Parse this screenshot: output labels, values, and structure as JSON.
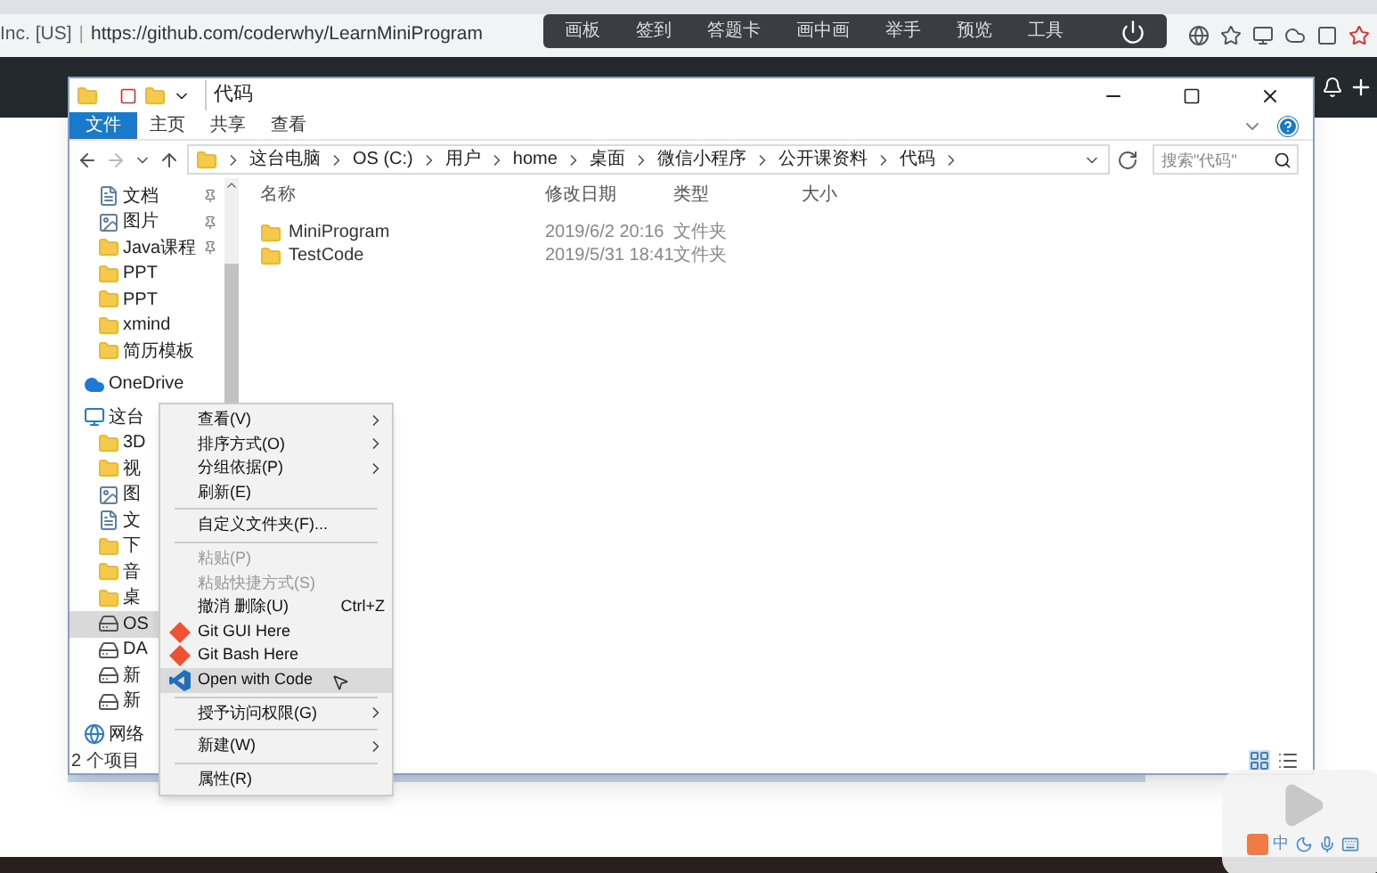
{
  "browser": {
    "site_label": "Inc. [US]",
    "separator": "|",
    "url": "https://github.com/coderwhy/LearnMiniProgram"
  },
  "share_toolbar": {
    "items": [
      "画板",
      "签到",
      "答题卡",
      "画中画",
      "举手",
      "预览",
      "工具"
    ]
  },
  "explorer": {
    "title": "代码",
    "ribbon_tabs": [
      {
        "label": "文件",
        "selected": true
      },
      {
        "label": "主页",
        "selected": false
      },
      {
        "label": "共享",
        "selected": false
      },
      {
        "label": "查看",
        "selected": false
      }
    ],
    "breadcrumb": [
      "这台电脑",
      "OS (C:)",
      "用户",
      "home",
      "桌面",
      "微信小程序",
      "公开课资料",
      "代码"
    ],
    "search": {
      "placeholder": "搜索\"代码\""
    },
    "columns": [
      "名称",
      "修改日期",
      "类型",
      "大小"
    ],
    "files": [
      {
        "name": "MiniProgram",
        "modified": "2019/6/2 20:16",
        "type": "文件夹"
      },
      {
        "name": "TestCode",
        "modified": "2019/5/31 18:41",
        "type": "文件夹"
      }
    ],
    "nav": [
      {
        "label": "文档",
        "kind": "doc",
        "pinned": true,
        "selected": false
      },
      {
        "label": "图片",
        "kind": "pic",
        "pinned": true,
        "selected": false
      },
      {
        "label": "Java课程",
        "kind": "folder",
        "pinned": true,
        "selected": false
      },
      {
        "label": "PPT",
        "kind": "folder",
        "pinned": false,
        "selected": false
      },
      {
        "label": "PPT",
        "kind": "folder",
        "pinned": false,
        "selected": false
      },
      {
        "label": "xmind",
        "kind": "folder",
        "pinned": false,
        "selected": false
      },
      {
        "label": "简历模板",
        "kind": "folder",
        "pinned": false,
        "selected": false
      },
      {
        "label": "OneDrive",
        "kind": "cloud",
        "pinned": false,
        "selected": false
      },
      {
        "label": "这台",
        "kind": "pc",
        "pinned": false,
        "selected": false
      },
      {
        "label": "3D",
        "kind": "folder",
        "pinned": false,
        "selected": false
      },
      {
        "label": "视",
        "kind": "folder",
        "pinned": false,
        "selected": false
      },
      {
        "label": "图",
        "kind": "pic",
        "pinned": false,
        "selected": false
      },
      {
        "label": "文",
        "kind": "doc",
        "pinned": false,
        "selected": false
      },
      {
        "label": "下",
        "kind": "folder",
        "pinned": false,
        "selected": false
      },
      {
        "label": "音",
        "kind": "folder",
        "pinned": false,
        "selected": false
      },
      {
        "label": "桌",
        "kind": "folder",
        "pinned": false,
        "selected": false
      },
      {
        "label": "OS",
        "kind": "drive",
        "pinned": false,
        "selected": true
      },
      {
        "label": "DA",
        "kind": "drive",
        "pinned": false,
        "selected": false
      },
      {
        "label": "新",
        "kind": "drive",
        "pinned": false,
        "selected": false
      },
      {
        "label": "新",
        "kind": "drive",
        "pinned": false,
        "selected": false
      },
      {
        "label": "网络",
        "kind": "network",
        "pinned": false,
        "selected": false
      }
    ],
    "status": "2 个项目"
  },
  "context_menu": [
    {
      "kind": "item",
      "label": "查看(V)",
      "submenu": true,
      "disabled": false,
      "selected": false
    },
    {
      "kind": "item",
      "label": "排序方式(O)",
      "submenu": true,
      "disabled": false,
      "selected": false
    },
    {
      "kind": "item",
      "label": "分组依据(P)",
      "submenu": true,
      "disabled": false,
      "selected": false
    },
    {
      "kind": "item",
      "label": "刷新(E)",
      "submenu": false,
      "disabled": false,
      "selected": false
    },
    {
      "kind": "separator"
    },
    {
      "kind": "item",
      "label": "自定义文件夹(F)...",
      "submenu": false,
      "disabled": false,
      "selected": false
    },
    {
      "kind": "separator"
    },
    {
      "kind": "item",
      "label": "粘贴(P)",
      "submenu": false,
      "disabled": true,
      "selected": false
    },
    {
      "kind": "item",
      "label": "粘贴快捷方式(S)",
      "submenu": false,
      "disabled": true,
      "selected": false
    },
    {
      "kind": "item",
      "label": "撤消 删除(U)",
      "shortcut": "Ctrl+Z",
      "submenu": false,
      "disabled": false,
      "selected": false
    },
    {
      "kind": "git",
      "label": "Git GUI Here",
      "submenu": false,
      "disabled": false,
      "selected": false
    },
    {
      "kind": "git",
      "label": "Git Bash Here",
      "submenu": false,
      "disabled": false,
      "selected": false
    },
    {
      "kind": "vscode",
      "label": "Open with Code",
      "submenu": false,
      "disabled": false,
      "selected": true
    },
    {
      "kind": "separator"
    },
    {
      "kind": "item",
      "label": "授予访问权限(G)",
      "submenu": true,
      "disabled": false,
      "selected": false
    },
    {
      "kind": "separator"
    },
    {
      "kind": "item",
      "label": "新建(W)",
      "submenu": true,
      "disabled": false,
      "selected": false
    },
    {
      "kind": "separator"
    },
    {
      "kind": "item",
      "label": "属性(R)",
      "submenu": false,
      "disabled": false,
      "selected": false
    }
  ],
  "ime": {
    "label": "中"
  }
}
